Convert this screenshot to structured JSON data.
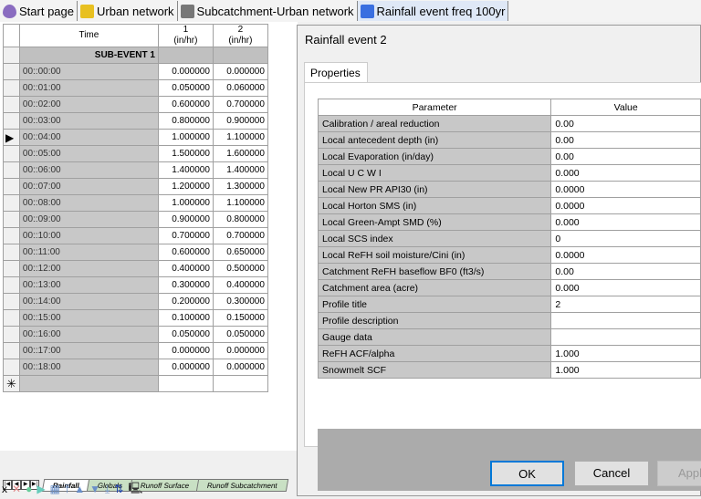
{
  "doc_tabs": [
    {
      "label": "Start page",
      "icon": "drop-icon",
      "color": "#8a6cc0"
    },
    {
      "label": "Urban network",
      "icon": "network-icon",
      "color": "#e8c020"
    },
    {
      "label": "Subcatchment-Urban network",
      "icon": "grid-icon",
      "color": "#777777"
    },
    {
      "label": "Rainfall event freq 100yr",
      "icon": "rainfall-icon",
      "color": "#3a6fe0"
    }
  ],
  "grid": {
    "headers": {
      "time": "Time",
      "c1": "1",
      "c1u": "(in/hr)",
      "c2": "2",
      "c2u": "(in/hr)"
    },
    "subevent": "SUB-EVENT 1",
    "new_row": "✳",
    "current_row_marker": "▶",
    "rows": [
      [
        "00::00:00",
        "0.000000",
        "0.000000"
      ],
      [
        "00::01:00",
        "0.050000",
        "0.060000"
      ],
      [
        "00::02:00",
        "0.600000",
        "0.700000"
      ],
      [
        "00::03:00",
        "0.800000",
        "0.900000"
      ],
      [
        "00::04:00",
        "1.000000",
        "1.100000"
      ],
      [
        "00::05:00",
        "1.500000",
        "1.600000"
      ],
      [
        "00::06:00",
        "1.400000",
        "1.400000"
      ],
      [
        "00::07:00",
        "1.200000",
        "1.300000"
      ],
      [
        "00::08:00",
        "1.000000",
        "1.100000"
      ],
      [
        "00::09:00",
        "0.900000",
        "0.800000"
      ],
      [
        "00::10:00",
        "0.700000",
        "0.700000"
      ],
      [
        "00::11:00",
        "0.600000",
        "0.650000"
      ],
      [
        "00::12:00",
        "0.400000",
        "0.500000"
      ],
      [
        "00::13:00",
        "0.300000",
        "0.400000"
      ],
      [
        "00::14:00",
        "0.200000",
        "0.300000"
      ],
      [
        "00::15:00",
        "0.100000",
        "0.150000"
      ],
      [
        "00::16:00",
        "0.050000",
        "0.050000"
      ],
      [
        "00::17:00",
        "0.000000",
        "0.000000"
      ],
      [
        "00::18:00",
        "0.000000",
        "0.000000"
      ]
    ]
  },
  "sheet_tabs": [
    "Rainfall",
    "Globals",
    "Runoff Surface",
    "Runoff Subcatchment"
  ],
  "dialog": {
    "title": "Rainfall event 2",
    "tab": "Properties",
    "col_param": "Parameter",
    "col_value": "Value",
    "props": [
      [
        "Calibration / areal reduction",
        "0.00"
      ],
      [
        "Local antecedent depth (in)",
        "0.00"
      ],
      [
        "Local Evaporation (in/day)",
        "0.00"
      ],
      [
        "Local U C W I",
        "0.000"
      ],
      [
        "Local New PR API30 (in)",
        "0.0000"
      ],
      [
        "Local Horton SMS (in)",
        "0.0000"
      ],
      [
        "Local Green-Ampt SMD (%)",
        "0.000"
      ],
      [
        "Local SCS index",
        "0"
      ],
      [
        "Local ReFH soil moisture/Cini (in)",
        "0.0000"
      ],
      [
        "Catchment ReFH baseflow BF0 (ft3/s)",
        "0.00"
      ],
      [
        "Catchment area (acre)",
        "0.000"
      ],
      [
        "Profile title",
        "2"
      ],
      [
        "Profile description",
        ""
      ],
      [
        "Gauge data",
        ""
      ],
      [
        "ReFH ACF/alpha",
        "1.000"
      ],
      [
        "Snowmelt SCF",
        "1.000"
      ]
    ],
    "ok": "OK",
    "cancel": "Cancel",
    "apply": "Apply"
  }
}
